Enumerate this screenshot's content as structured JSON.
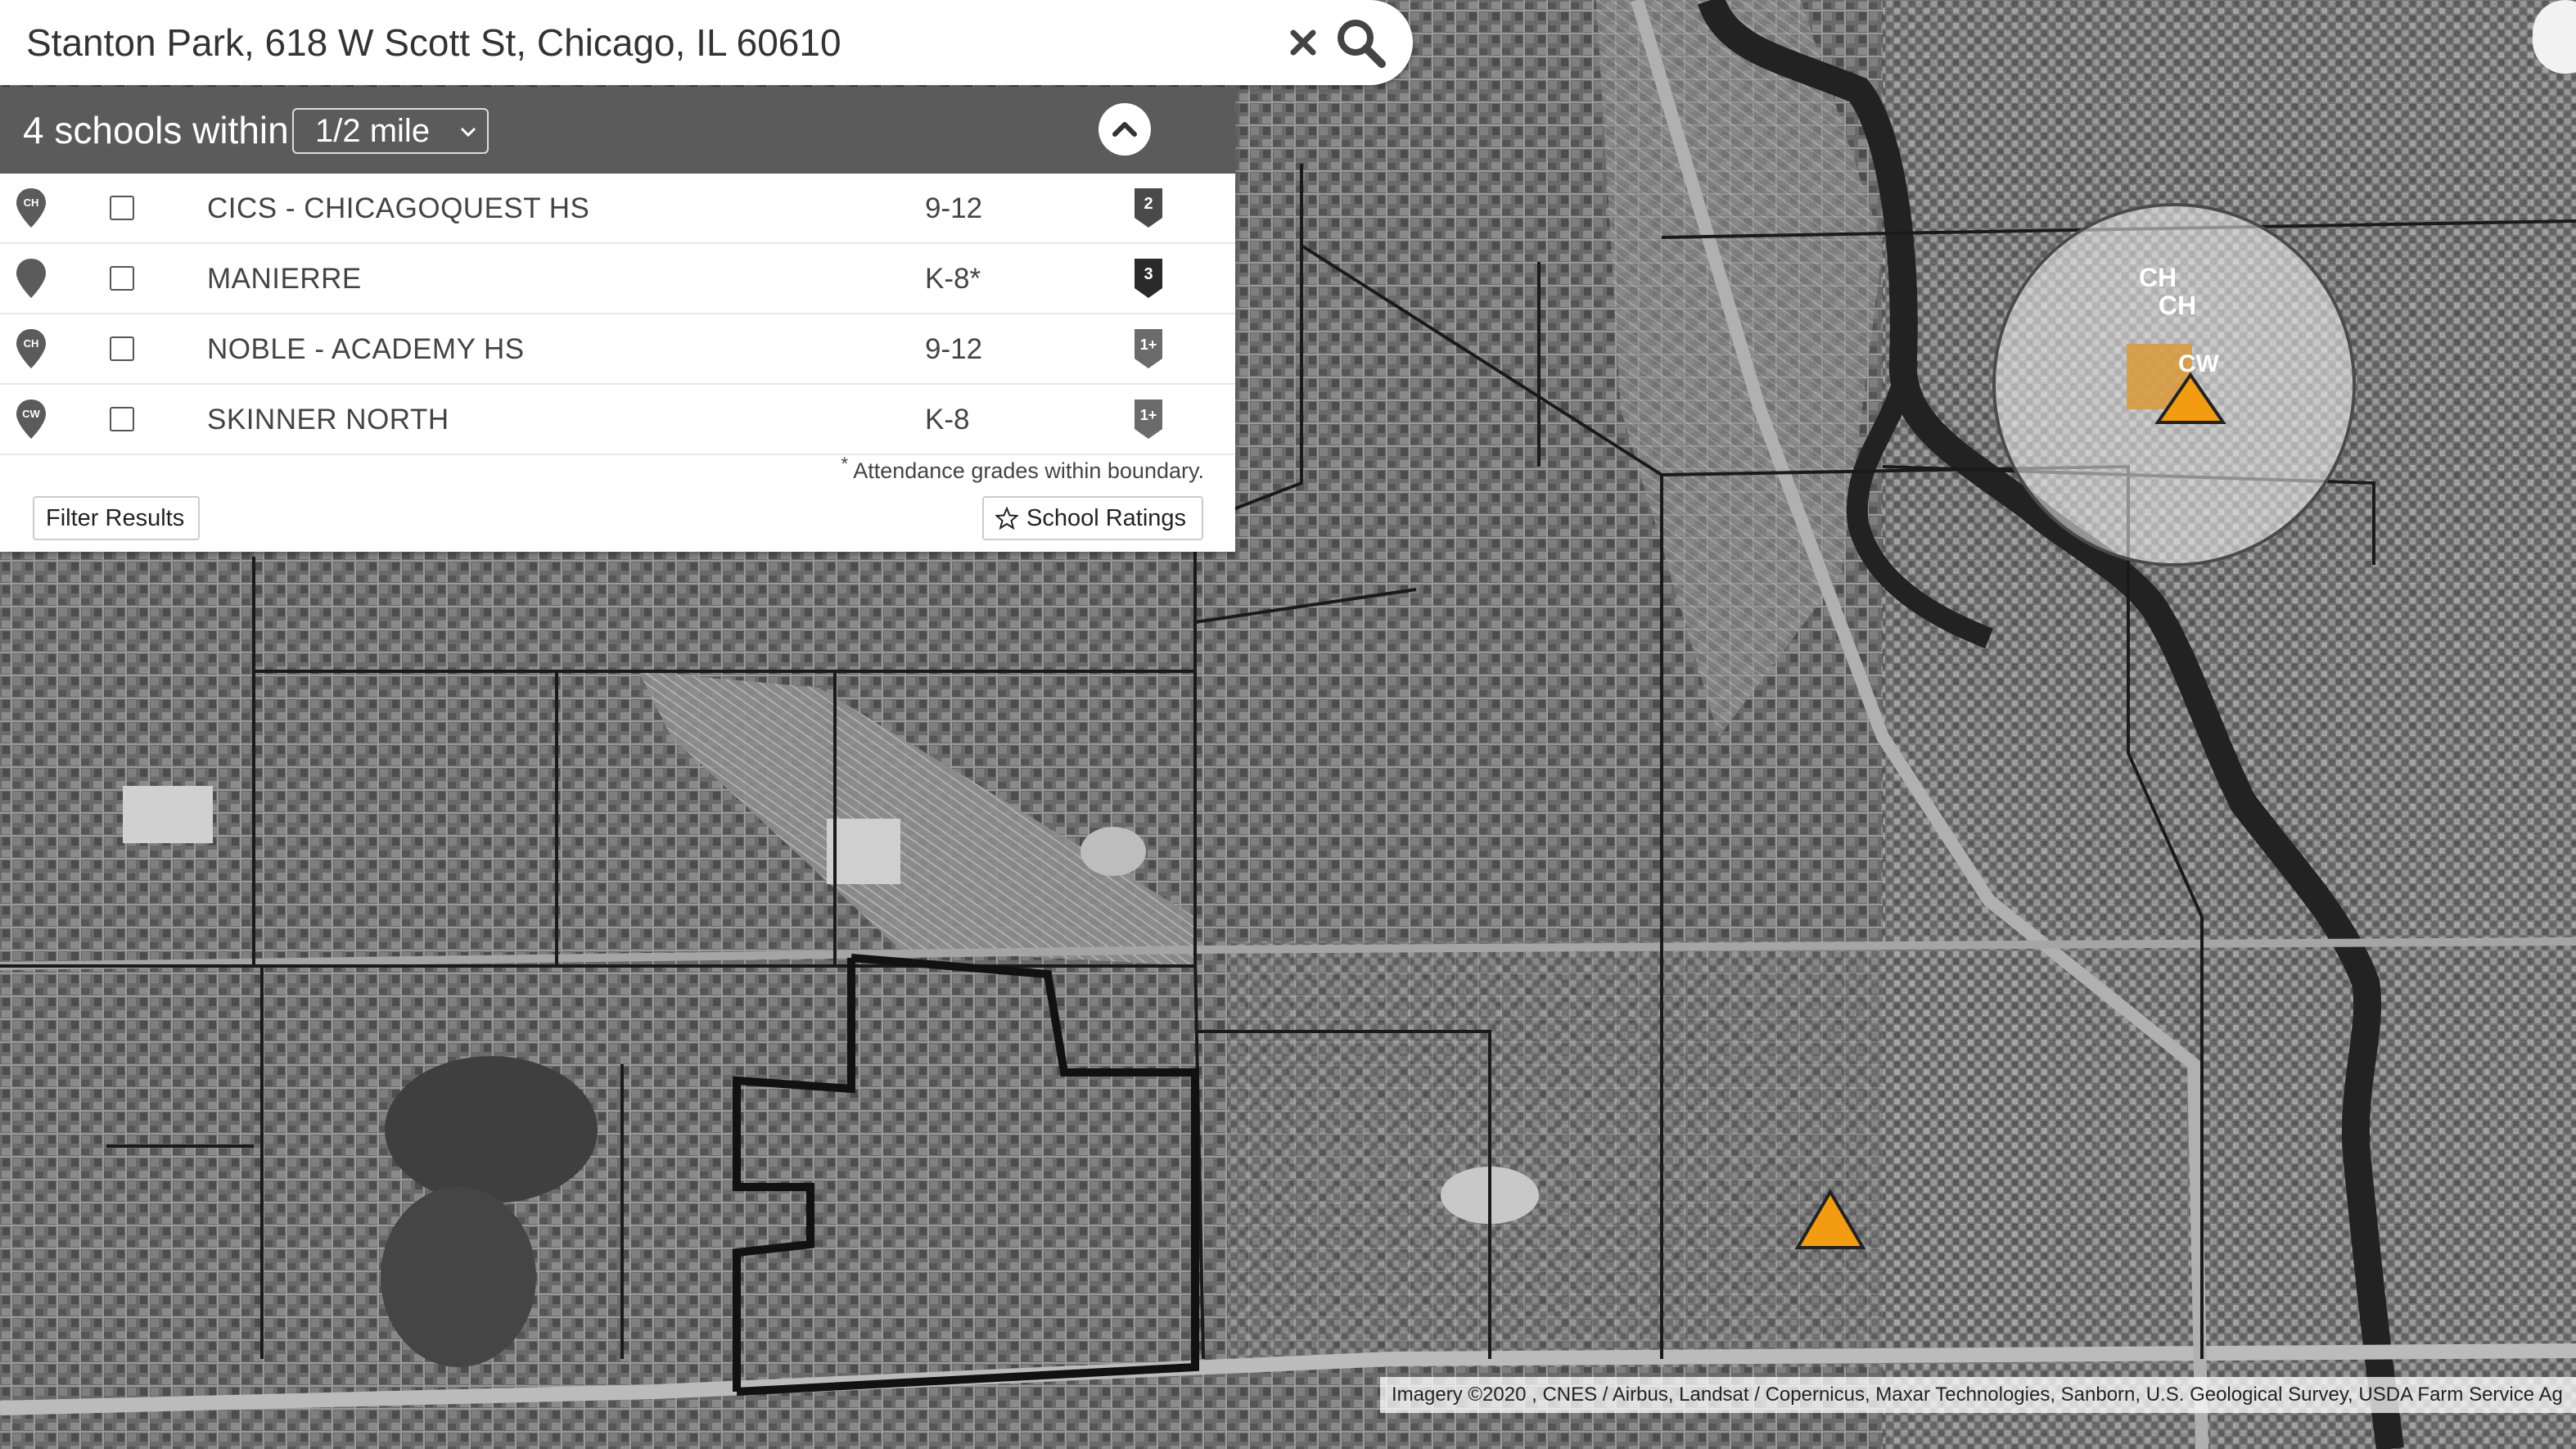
{
  "search": {
    "value": "Stanton Park, 618 W Scott St, Chicago, IL 60610",
    "clear_icon": "close-icon",
    "search_icon": "search-icon"
  },
  "panel": {
    "count_text": "4 schools within",
    "distance_selected": "1/2 mile",
    "collapse_icon": "chevron-up-icon"
  },
  "schools": [
    {
      "name": "CICS - CHICAGOQUEST HS",
      "grades": "9-12",
      "pin_label": "CH",
      "rating": "2"
    },
    {
      "name": "MANIERRE",
      "grades": "K-8*",
      "pin_label": "",
      "rating": "3"
    },
    {
      "name": "NOBLE - ACADEMY HS",
      "grades": "9-12",
      "pin_label": "CH",
      "rating": "1+"
    },
    {
      "name": "SKINNER NORTH",
      "grades": "K-8",
      "pin_label": "CW",
      "rating": "1+"
    }
  ],
  "footnote": {
    "mark": "*",
    "text": "Attendance grades within boundary."
  },
  "buttons": {
    "filter": "Filter Results",
    "ratings": "School Ratings",
    "ratings_icon": "star-icon"
  },
  "map": {
    "type": "satellite-grayscale",
    "circle_labels": [
      "CH",
      "CH",
      "CW"
    ],
    "marker_color": "#f39c12",
    "attribution": "Imagery ©2020 , CNES / Airbus, Landsat / Copernicus, Maxar Technologies, Sanborn, U.S. Geological Survey, USDA Farm Service Ag"
  },
  "colors": {
    "panel_header": "#5b5b5b",
    "marker": "#f39c12",
    "highlight": "#d99a3a"
  }
}
